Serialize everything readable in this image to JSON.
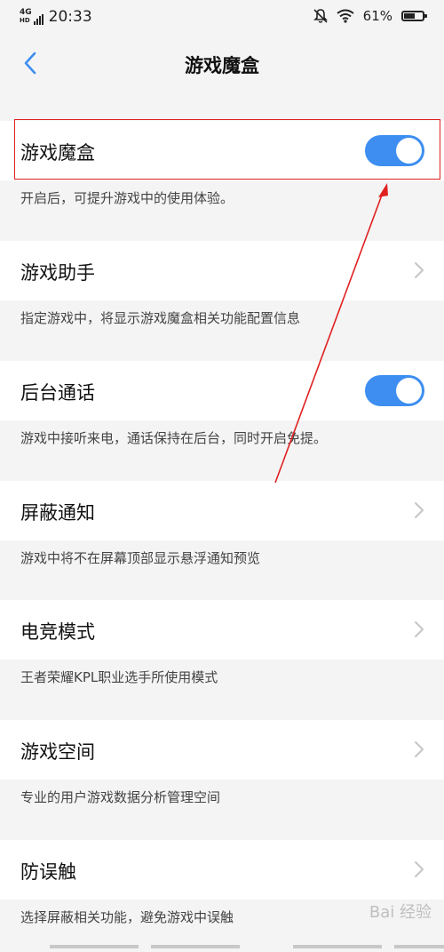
{
  "status": {
    "network": "4G",
    "network_sub": "HD",
    "time": "20:33",
    "battery": "61%",
    "battery_level": 0.61
  },
  "nav": {
    "title": "游戏魔盒",
    "back_icon": "chevron-left-icon"
  },
  "settings": [
    {
      "label": "游戏魔盒",
      "control": "toggle",
      "on": true,
      "desc": "开启后，可提升游戏中的使用体验。"
    },
    {
      "label": "游戏助手",
      "control": "chevron",
      "desc": "指定游戏中，将显示游戏魔盒相关功能配置信息"
    },
    {
      "label": "后台通话",
      "control": "toggle",
      "on": true,
      "desc": "游戏中接听来电，通话保持在后台，同时开启免提。"
    },
    {
      "label": "屏蔽通知",
      "control": "chevron",
      "desc": "游戏中将不在屏幕顶部显示悬浮通知预览"
    },
    {
      "label": "电竞模式",
      "control": "chevron",
      "desc": "王者荣耀KPL职业选手所使用模式"
    },
    {
      "label": "游戏空间",
      "control": "chevron",
      "desc": "专业的用户游戏数据分析管理空间"
    },
    {
      "label": "防误触",
      "control": "chevron",
      "desc": "选择屏蔽相关功能，避免游戏中误触"
    }
  ],
  "colors": {
    "accent": "#3d8ef0",
    "annotation": "#e02020",
    "background": "#f4f4f4"
  },
  "watermark": "Bai 经验"
}
